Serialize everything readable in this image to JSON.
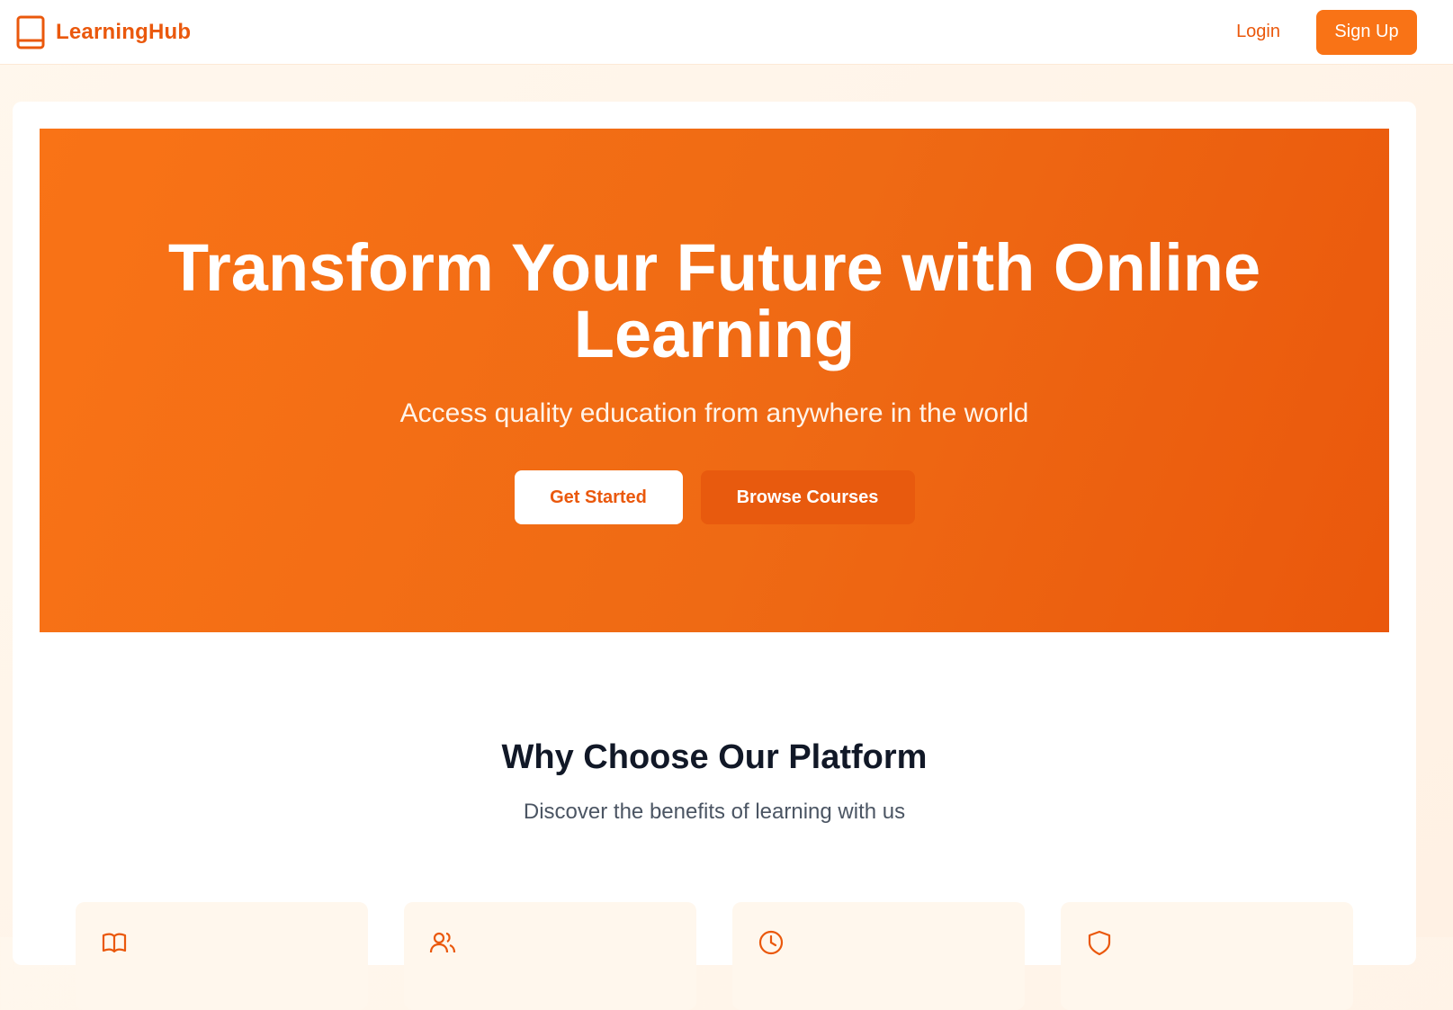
{
  "header": {
    "brand": "LearningHub",
    "login_label": "Login",
    "signup_label": "Sign Up"
  },
  "hero": {
    "title": "Transform Your Future with Online Learning",
    "subtitle": "Access quality education from anywhere in the world",
    "primary_cta": "Get Started",
    "secondary_cta": "Browse Courses"
  },
  "features": {
    "title": "Why Choose Our Platform",
    "subtitle": "Discover the benefits of learning with us",
    "cards": [
      {
        "icon": "book-open-icon"
      },
      {
        "icon": "users-icon"
      },
      {
        "icon": "clock-icon"
      },
      {
        "icon": "shield-icon"
      }
    ]
  },
  "colors": {
    "accent": "#f97316",
    "accent_dark": "#ea580c",
    "page_background": "#fff7ed",
    "heading": "#111827",
    "muted_text": "#4b5563"
  }
}
